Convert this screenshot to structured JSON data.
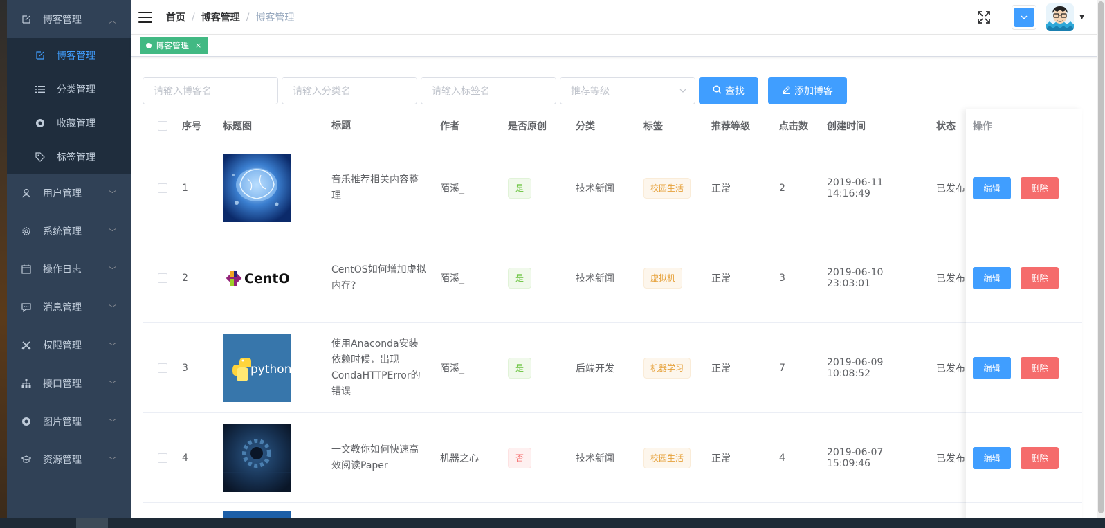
{
  "sidebar": {
    "menus": [
      {
        "label": "博客管理",
        "icon": "edit-icon",
        "expanded": true,
        "children": [
          {
            "label": "博客管理",
            "icon": "edit-icon",
            "active": true
          },
          {
            "label": "分类管理",
            "icon": "list-icon"
          },
          {
            "label": "收藏管理",
            "icon": "lifebuoy-icon"
          },
          {
            "label": "标签管理",
            "icon": "tag-icon"
          }
        ]
      },
      {
        "label": "用户管理",
        "icon": "user-icon"
      },
      {
        "label": "系统管理",
        "icon": "gear-icon"
      },
      {
        "label": "操作日志",
        "icon": "calendar-icon"
      },
      {
        "label": "消息管理",
        "icon": "message-icon"
      },
      {
        "label": "权限管理",
        "icon": "scissors-icon"
      },
      {
        "label": "接口管理",
        "icon": "sitemap-icon"
      },
      {
        "label": "图片管理",
        "icon": "lifebuoy-icon"
      },
      {
        "label": "资源管理",
        "icon": "graduation-cap-icon"
      }
    ]
  },
  "navbar": {
    "breadcrumb": [
      "首页",
      "博客管理",
      "博客管理"
    ]
  },
  "tags_view": {
    "tags": [
      {
        "label": "博客管理",
        "close": "×"
      }
    ]
  },
  "filters": {
    "blog_name_placeholder": "请输入博客名",
    "category_placeholder": "请输入分类名",
    "tag_placeholder": "请输入标签名",
    "level_placeholder": "推荐等级",
    "search_label": "查找",
    "add_label": "添加博客"
  },
  "table": {
    "headers": [
      "序号",
      "标题图",
      "标题",
      "作者",
      "是否原创",
      "分类",
      "标签",
      "推荐等级",
      "点击数",
      "创建时间",
      "状态",
      "操作"
    ],
    "rows": [
      {
        "index": "1",
        "image": "brain-image",
        "title": "音乐推荐相关内容整理",
        "author": "陌溪_",
        "original": "是",
        "category": "技术新闻",
        "tag": "校园生活",
        "level": "正常",
        "clicks": "2",
        "created": "2019-06-11 14:16:49",
        "status": "已发布"
      },
      {
        "index": "2",
        "image": "centos-logo",
        "title": "CentOS如何增加虚拟内存?",
        "author": "陌溪_",
        "original": "是",
        "category": "技术新闻",
        "tag": "虚拟机",
        "level": "正常",
        "clicks": "3",
        "created": "2019-06-10 23:03:01",
        "status": "已发布"
      },
      {
        "index": "3",
        "image": "python-logo",
        "title": "使用Anaconda安装依赖时候，出现CondaHTTPError的错误",
        "author": "陌溪_",
        "original": "是",
        "category": "后端开发",
        "tag": "机器学习",
        "level": "正常",
        "clicks": "7",
        "created": "2019-06-09 10:08:52",
        "status": "已发布"
      },
      {
        "index": "4",
        "image": "dark-tech-image",
        "title": "一文教你如何快速高效阅读Paper",
        "author": "机器之心",
        "original": "否",
        "category": "技术新闻",
        "tag": "校园生活",
        "level": "正常",
        "clicks": "4",
        "created": "2019-06-07 15:09:46",
        "status": "已发布"
      }
    ],
    "edit_label": "编辑",
    "delete_label": "删除"
  },
  "centos_text": "CentOS",
  "python_text": "python",
  "colors": {
    "sidebar_bg": "#304156",
    "submenu_bg": "#1f2d3d",
    "primary": "#409eff",
    "danger": "#f56c6c",
    "tag_green": "#42b983"
  }
}
